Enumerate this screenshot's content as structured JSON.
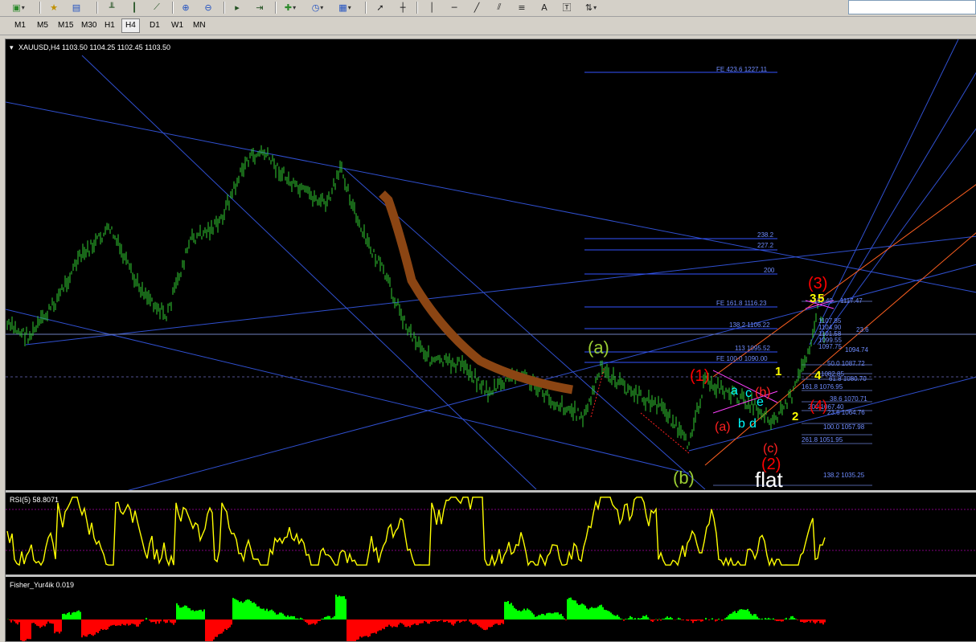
{
  "toolbar": {
    "buttons": [
      "new-chart-icon",
      "profiles-icon",
      "properties-icon",
      "bar-chart-icon",
      "candlesticks-icon",
      "line-chart-icon",
      "zoom-in-icon",
      "zoom-out-icon",
      "autoscroll-icon",
      "chart-shift-icon",
      "indicators-icon",
      "periods-icon",
      "templates-icon",
      "cursor-icon",
      "crosshair-icon",
      "vertical-line-icon",
      "horizontal-line-icon",
      "trendline-icon",
      "equidistant-channel-icon",
      "fibonacci-icon",
      "text-icon",
      "text-label-icon",
      "arrows-icon"
    ],
    "text_button": "A"
  },
  "timeframes": [
    "M1",
    "M5",
    "M15",
    "M30",
    "H1",
    "H4",
    "D1",
    "W1",
    "MN"
  ],
  "active_timeframe": "H4",
  "chart": {
    "header": "XAUUSD,H4  1103.50 1104.25 1102.45 1103.50",
    "levels": {
      "fe4236": "FE 423.6 1227.11",
      "l2382": "238.2",
      "l2272": "227.2",
      "l200": "200",
      "fe1618": "FE 161.8 1116.23",
      "l1382": "138.2 1106.22",
      "l113": "113 1095.52",
      "fe100": "FE 100.0 1090.00",
      "r236": "23.6",
      "r1094": "1094.74",
      "r500": "50.0 1087.72",
      "r1082": "1082.85",
      "r618b": "61.8 1080.70",
      "r1618": "161.8 1076.95",
      "r1070": "38.6 1070.71",
      "r1067": "200 1067.40",
      "r1064": "23.6 1064.76",
      "r1000": "100.0 1057.98",
      "r2618": "261.8 1051.95",
      "r1382b": "138.2 1035.25",
      "r1117": "1117.47",
      "r1117b": "112.40",
      "r1107": "1107.85",
      "r1104": "1104.90",
      "r1101": "1101.58",
      "r1099": "1099.55",
      "r1097": "1097.75"
    },
    "waves": {
      "a_big": "(a)",
      "b_big": "(b)",
      "w1": "(1)",
      "w2": "(2)",
      "w3": "(3)",
      "w4": "(4)",
      "a_small": "(a)",
      "b_small": "(b)",
      "c_small": "(c)",
      "flat": "flat",
      "sub1": "1",
      "sub2": "2",
      "sub3": "3",
      "sub4": "4",
      "sub5": "5",
      "ta": "a",
      "tb": "b",
      "tc": "c",
      "td": "d",
      "te": "e"
    },
    "colors": {
      "price": "#32cd32",
      "fib": "#4169e1",
      "channel": "#3050d0",
      "brush": "#8b4513",
      "wave_red": "#ff0000",
      "wave_olive": "#9acd32",
      "wave_yellow": "#ffff00",
      "wave_cyan": "#00ffff"
    }
  },
  "rsi": {
    "label": "RSI(5) 58.8071",
    "color": "#ffff00"
  },
  "fisher": {
    "label": "Fisher_Yur4ik 0.019",
    "pos_color": "#00ff00",
    "neg_color": "#ff0000"
  }
}
